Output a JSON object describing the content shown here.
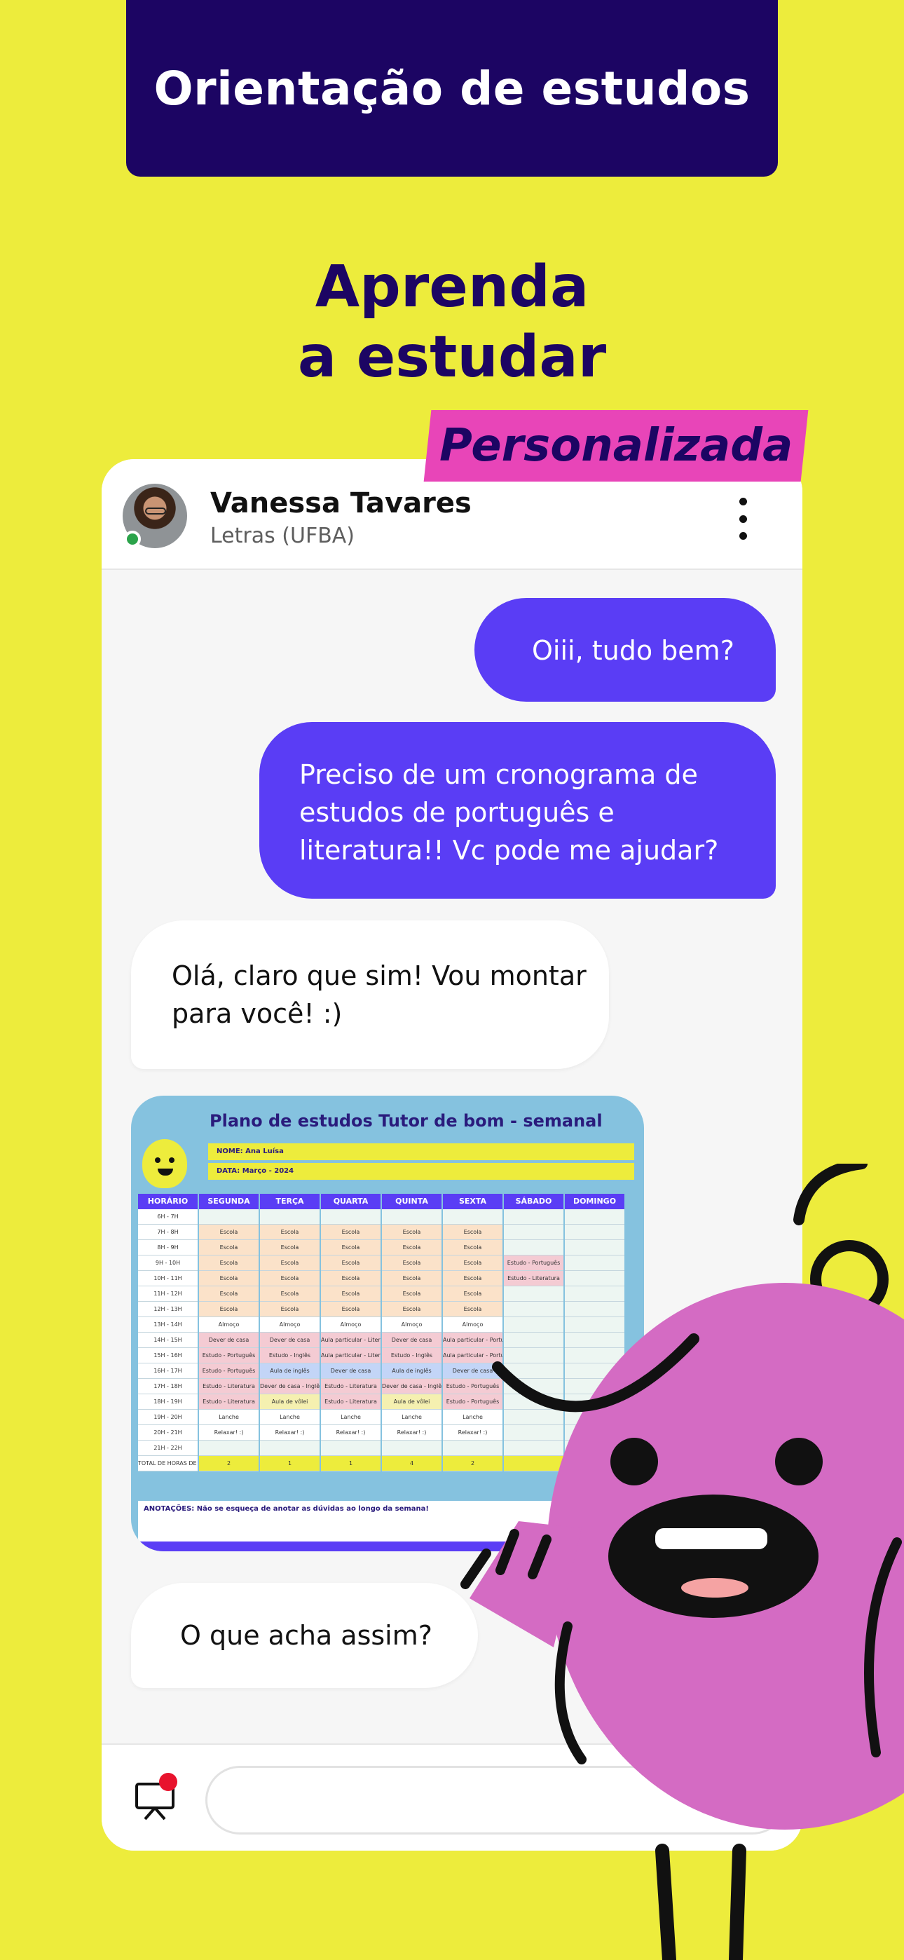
{
  "banner": {
    "title": "Orientação de estudos"
  },
  "headline": {
    "line1": "Aprenda",
    "line2": "a estudar",
    "tag": "Personalizada"
  },
  "chat": {
    "contact_name": "Vanessa Tavares",
    "contact_subtitle": "Letras (UFBA)",
    "messages": [
      {
        "from": "user",
        "text": "Oiii, tudo bem?"
      },
      {
        "from": "user",
        "text": "Preciso de um cronograma de estudos de português e literatura!! Vc pode me ajudar?"
      },
      {
        "from": "tutor",
        "text": "Olá, claro que sim! Vou montar para você! :)"
      },
      {
        "from": "tutor",
        "text": "O que acha assim?"
      }
    ],
    "input_placeholder": ""
  },
  "plan": {
    "title": "Plano de estudos Tutor de bom - semanal",
    "name_field": "NOME: Ana Luísa",
    "date_field": "DATA: Março - 2024",
    "columns": [
      "HORÁRIO",
      "SEGUNDA",
      "TERÇA",
      "QUARTA",
      "QUINTA",
      "SEXTA",
      "SÁBADO",
      "DOMINGO"
    ],
    "rows": [
      [
        "6H - 7H",
        "",
        "",
        "",
        "",
        "",
        "",
        ""
      ],
      [
        "7H - 8H",
        "Escola",
        "Escola",
        "Escola",
        "Escola",
        "Escola",
        "",
        ""
      ],
      [
        "8H - 9H",
        "Escola",
        "Escola",
        "Escola",
        "Escola",
        "Escola",
        "",
        ""
      ],
      [
        "9H - 10H",
        "Escola",
        "Escola",
        "Escola",
        "Escola",
        "Escola",
        "Estudo - Português",
        ""
      ],
      [
        "10H - 11H",
        "Escola",
        "Escola",
        "Escola",
        "Escola",
        "Escola",
        "Estudo - Literatura",
        ""
      ],
      [
        "11H - 12H",
        "Escola",
        "Escola",
        "Escola",
        "Escola",
        "Escola",
        "",
        ""
      ],
      [
        "12H - 13H",
        "Escola",
        "Escola",
        "Escola",
        "Escola",
        "Escola",
        "",
        ""
      ],
      [
        "13H - 14H",
        "Almoço",
        "Almoço",
        "Almoço",
        "Almoço",
        "Almoço",
        "",
        ""
      ],
      [
        "14H - 15H",
        "Dever de casa",
        "Dever de casa",
        "Aula particular - Literatura",
        "Dever de casa",
        "Aula particular - Português",
        "",
        ""
      ],
      [
        "15H - 16H",
        "Estudo - Português",
        "Estudo - Inglês",
        "Aula particular - Literatura",
        "Estudo - Inglês",
        "Aula particular - Português",
        "",
        ""
      ],
      [
        "16H - 17H",
        "Estudo - Português",
        "Aula de inglês",
        "Dever de casa",
        "Aula de inglês",
        "Dever de casa",
        "",
        ""
      ],
      [
        "17H - 18H",
        "Estudo - Literatura",
        "Dever de casa - Inglês",
        "Estudo - Literatura",
        "Dever de casa - Inglês",
        "Estudo - Português",
        "",
        ""
      ],
      [
        "18H - 19H",
        "Estudo - Literatura",
        "Aula de vôlei",
        "Estudo - Literatura",
        "Aula de vôlei",
        "Estudo - Português",
        "",
        ""
      ],
      [
        "19H - 20H",
        "Lanche",
        "Lanche",
        "Lanche",
        "Lanche",
        "Lanche",
        "",
        ""
      ],
      [
        "20H - 21H",
        "Relaxar! :)",
        "Relaxar! :)",
        "Relaxar! :)",
        "Relaxar! :)",
        "Relaxar! :)",
        "",
        ""
      ],
      [
        "21H - 22H",
        "",
        "",
        "",
        "",
        "",
        "",
        ""
      ],
      [
        "TOTAL DE HORAS DE ESTUDOS",
        "2",
        "1",
        "1",
        "4",
        "2",
        "",
        ""
      ]
    ],
    "notes": "ANOTAÇÕES: Não se esqueça de anotar as dúvidas ao longo da semana!"
  },
  "icons": {
    "menu": "kebab-menu-icon",
    "board": "whiteboard-icon",
    "notification": "notification-dot"
  },
  "colors": {
    "background": "#EDEC3C",
    "navy": "#1C0563",
    "purple": "#5A3DF5",
    "pink": "#E845B8",
    "mascot": "#D46BC3"
  }
}
